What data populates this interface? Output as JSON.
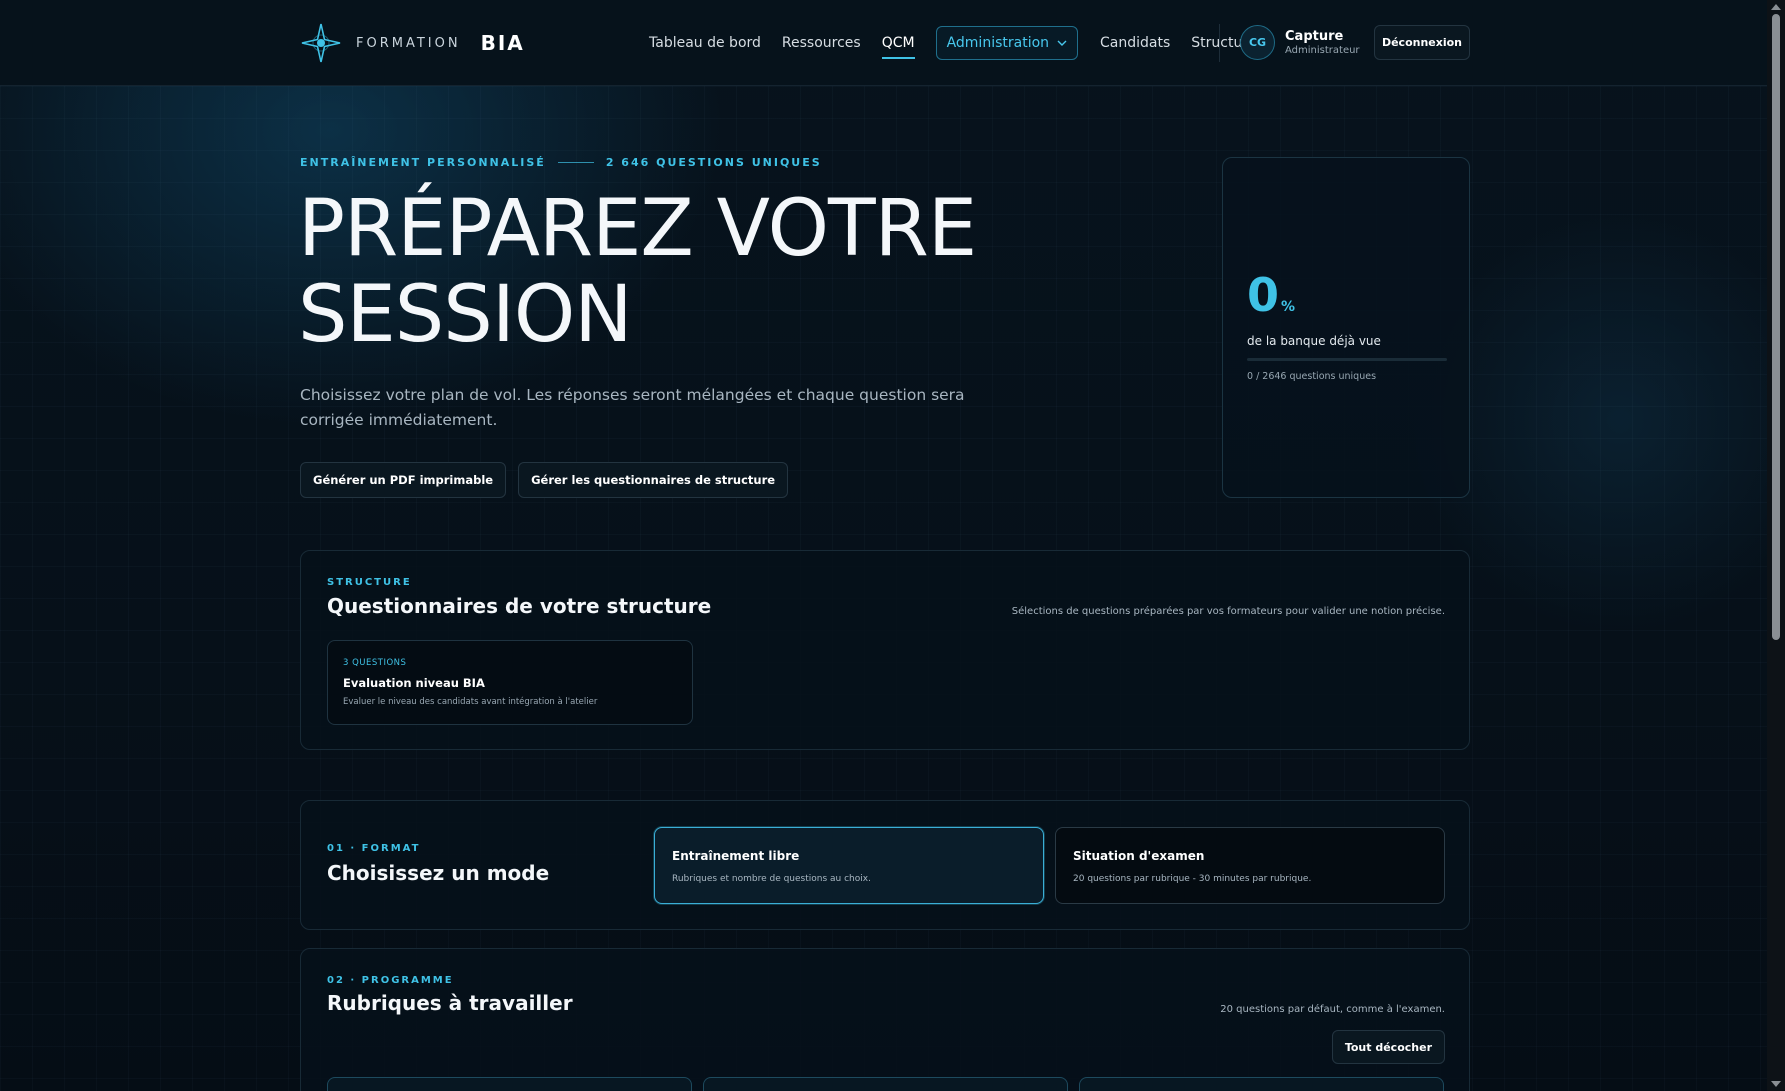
{
  "brand": {
    "sub": "FORMATION",
    "main": "BIA"
  },
  "nav": {
    "items": [
      "Tableau de bord",
      "Ressources",
      "QCM"
    ],
    "admin": "Administration",
    "items2": [
      "Candidats",
      "Structures"
    ]
  },
  "user": {
    "initials": "CG",
    "name": "Capture",
    "role": "Administrateur"
  },
  "logout_label": "Déconnexion",
  "hero": {
    "eyebrow_left": "ENTRAÎNEMENT PERSONNALISÉ",
    "eyebrow_right": "2 646 QUESTIONS UNIQUES",
    "title": "PRÉPAREZ VOTRE SESSION",
    "description": "Choisissez votre plan de vol. Les réponses seront mélangées et chaque question sera corrigée immédiatement.",
    "buttons": [
      "Générer un PDF imprimable",
      "Gérer les questionnaires de structure"
    ]
  },
  "stat": {
    "value": "0",
    "unit": "%",
    "label": "de la banque déjà vue",
    "progress_percent": 0,
    "sub": "0 / 2646 questions uniques"
  },
  "structure": {
    "kicker": "STRUCTURE",
    "title": "Questionnaires de votre structure",
    "note": "Sélections de questions préparées par vos formateurs pour valider une notion précise.",
    "quiz": {
      "count": "3 QUESTIONS",
      "title": "Evaluation niveau BIA",
      "description": "Evaluer le niveau des candidats avant intégration à l'atelier"
    }
  },
  "format": {
    "kicker": "01 · FORMAT",
    "title": "Choisissez un mode",
    "modes": [
      {
        "title": "Entraînement libre",
        "description": "Rubriques et nombre de questions au choix.",
        "selected": true
      },
      {
        "title": "Situation d'examen",
        "description": "20 questions par rubrique - 30 minutes par rubrique.",
        "selected": false
      }
    ]
  },
  "program": {
    "kicker": "02 · PROGRAMME",
    "title": "Rubriques à travailler",
    "note": "20 questions par défaut, comme à l'examen.",
    "uncheck_label": "Tout décocher"
  },
  "colors": {
    "accent": "#3fc2e6",
    "background": "#061019",
    "panel_border": "#182a36"
  }
}
